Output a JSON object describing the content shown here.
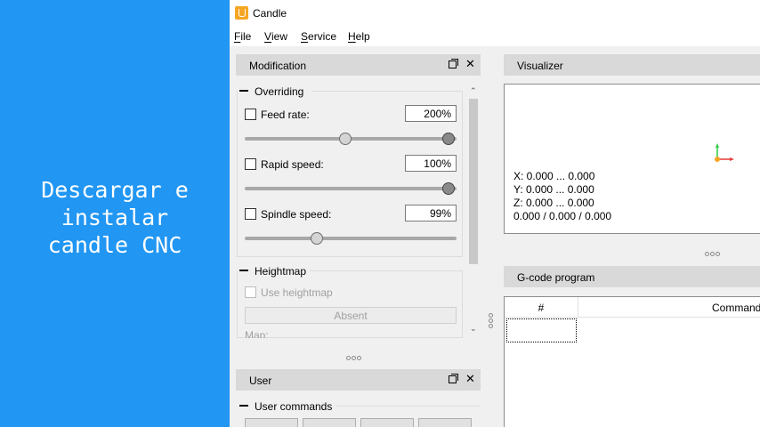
{
  "banner": {
    "text": "Descargar e\ninstalar\ncandle CNC",
    "color": "#2196f3"
  },
  "window": {
    "title": "Candle",
    "icon": "candle-app-icon"
  },
  "menu": {
    "items": [
      {
        "key": "F",
        "rest": "ile"
      },
      {
        "key": "V",
        "rest": "iew"
      },
      {
        "key": "S",
        "rest": "ervice"
      },
      {
        "key": "H",
        "rest": "elp"
      }
    ]
  },
  "modification": {
    "title": "Modification",
    "overriding": {
      "title": "Overriding",
      "feed": {
        "label": "Feed rate:",
        "value": "200%"
      },
      "rapid": {
        "label": "Rapid speed:",
        "value": "100%"
      },
      "spindle": {
        "label": "Spindle speed:",
        "value": "99%"
      }
    },
    "heightmap": {
      "title": "Heightmap",
      "use_label": "Use heightmap",
      "absent_label": "Absent",
      "map_label": "Map:"
    }
  },
  "user": {
    "title": "User",
    "commands_title": "User commands"
  },
  "visualizer": {
    "title": "Visualizer",
    "coords": [
      "X: 0.000 ... 0.000",
      "Y: 0.000 ... 0.000",
      "Z: 0.000 ... 0.000",
      "0.000 / 0.000 / 0.000"
    ]
  },
  "gcode": {
    "title": "G-code program",
    "columns": [
      "#",
      "Command"
    ]
  }
}
